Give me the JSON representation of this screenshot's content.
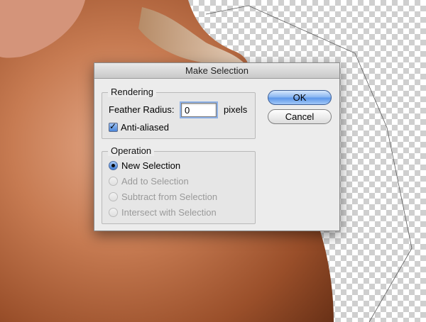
{
  "dialog": {
    "title": "Make Selection",
    "rendering": {
      "group_label": "Rendering",
      "feather_label": "Feather Radius:",
      "feather_value": "0",
      "feather_unit": "pixels",
      "anti_aliased_label": "Anti-aliased",
      "anti_aliased_checked": true
    },
    "operation": {
      "group_label": "Operation",
      "options": [
        {
          "label": "New Selection",
          "selected": true,
          "enabled": true
        },
        {
          "label": "Add to Selection",
          "selected": false,
          "enabled": false
        },
        {
          "label": "Subtract from Selection",
          "selected": false,
          "enabled": false
        },
        {
          "label": "Intersect with Selection",
          "selected": false,
          "enabled": false
        }
      ]
    },
    "buttons": {
      "ok_label": "OK",
      "cancel_label": "Cancel"
    }
  },
  "colors": {
    "accent": "#5d98ea",
    "skin_dark": "#7a3a1a",
    "skin_light": "#d89a78"
  }
}
